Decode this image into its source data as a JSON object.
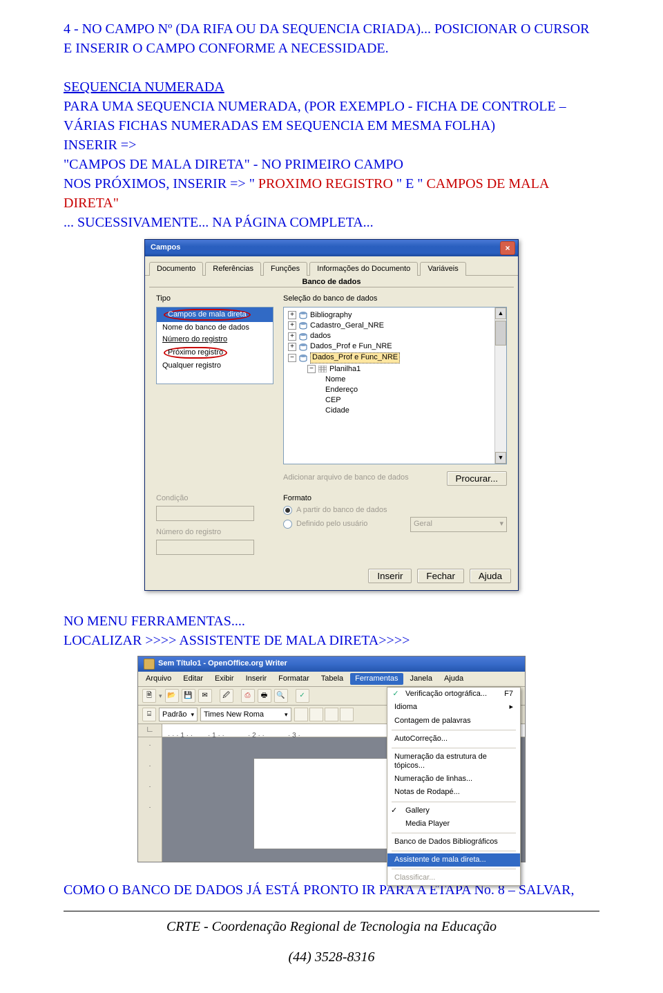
{
  "doc": {
    "section4_line1": "4 - NO CAMPO Nº (DA RIFA OU DA SEQUENCIA CRIADA)... POSICIONAR O CURSOR",
    "section4_line2": "E INSERIR O CAMPO CONFORME A NECESSIDADE.",
    "seq_numerada_title": "SEQUENCIA NUMERADA",
    "seq_para1": "PARA UMA SEQUENCIA NUMERADA, (POR EXEMPLO - FICHA DE CONTROLE –",
    "seq_para2": "VÁRIAS FICHAS NUMERADAS EM SEQUENCIA EM MESMA FOLHA)",
    "seq_inserir": "INSERIR =>",
    "seq_campos": "\"CAMPOS DE MALA DIRETA\" - NO PRIMEIRO CAMPO",
    "seq_prox1": "NOS PRÓXIMOS, INSERIR => \"",
    "seq_prox_red": "PROXIMO REGISTRO",
    "seq_prox_e": "\"  E \"",
    "seq_campos_red": "CAMPOS DE MALA",
    "seq_direta_red": "DIRETA\"",
    "seq_sucess": "... SUCESSIVAMENTE... NA PÁGINA COMPLETA...",
    "ferramentas_line1": "NO MENU FERRAMENTAS....",
    "ferramentas_line2": "LOCALIZAR  >>>>                ASSISTENTE DE MALA DIRETA>>>>",
    "etapa8_line": "COMO O BANCO DE DADOS JÁ ESTÁ PRONTO IR PARA A ETAPA No. 8 – SALVAR,",
    "footer_org": "CRTE - Coordenação Regional de Tecnologia na Educação",
    "footer_phone": "(44) 3528-8316"
  },
  "dialog": {
    "title": "Campos",
    "tabs": [
      "Documento",
      "Referências",
      "Funções",
      "Informações do Documento",
      "Variáveis"
    ],
    "active_tab": "Banco de dados",
    "tipo_label": "Tipo",
    "tipo_items": [
      "Campos de mala direta",
      "Nome do banco de dados",
      "Número do registro",
      "Próximo registro",
      "Qualquer registro"
    ],
    "selecao_label": "Seleção do banco de dados",
    "tree": [
      "Bibliography",
      "Cadastro_Geral_NRE",
      "dados",
      "Dados_Prof e Fun_NRE",
      "Dados_Prof e Func_NRE"
    ],
    "tree_planilha": "Planilha1",
    "tree_fields": [
      "Nome",
      "Endereço",
      "CEP",
      "Cidade"
    ],
    "add_db_label": "Adicionar arquivo de banco de dados",
    "procurar_btn": "Procurar...",
    "condicao_label": "Condição",
    "numreg_label": "Número do registro",
    "formato_label": "Formato",
    "radio_db": "A partir do banco de dados",
    "radio_user": "Definido pelo usuário",
    "format_value": "Geral",
    "btn_inserir": "Inserir",
    "btn_fechar": "Fechar",
    "btn_ajuda": "Ajuda"
  },
  "writer": {
    "title": "Sem Título1 - OpenOffice.org Writer",
    "menus": [
      "Arquivo",
      "Editar",
      "Exibir",
      "Inserir",
      "Formatar",
      "Tabela",
      "Ferramentas",
      "Janela",
      "Ajuda"
    ],
    "style": "Padrão",
    "font": "Times New Roma",
    "ruler": [
      "· · · 1 · ·",
      "· 1 · ·",
      "· 2 · ·",
      "· 3 ·"
    ],
    "dropdown": [
      "Verificação ortográfica...",
      "Idioma",
      "Contagem de palavras",
      "AutoCorreção...",
      "Numeração da estrutura de tópicos...",
      "Numeração de linhas...",
      "Notas de Rodapé...",
      "Gallery",
      "Media Player",
      "Banco de Dados Bibliográficos",
      "Assistente de mala direta...",
      "Classificar..."
    ],
    "dropdown_sc": [
      "F7"
    ]
  }
}
